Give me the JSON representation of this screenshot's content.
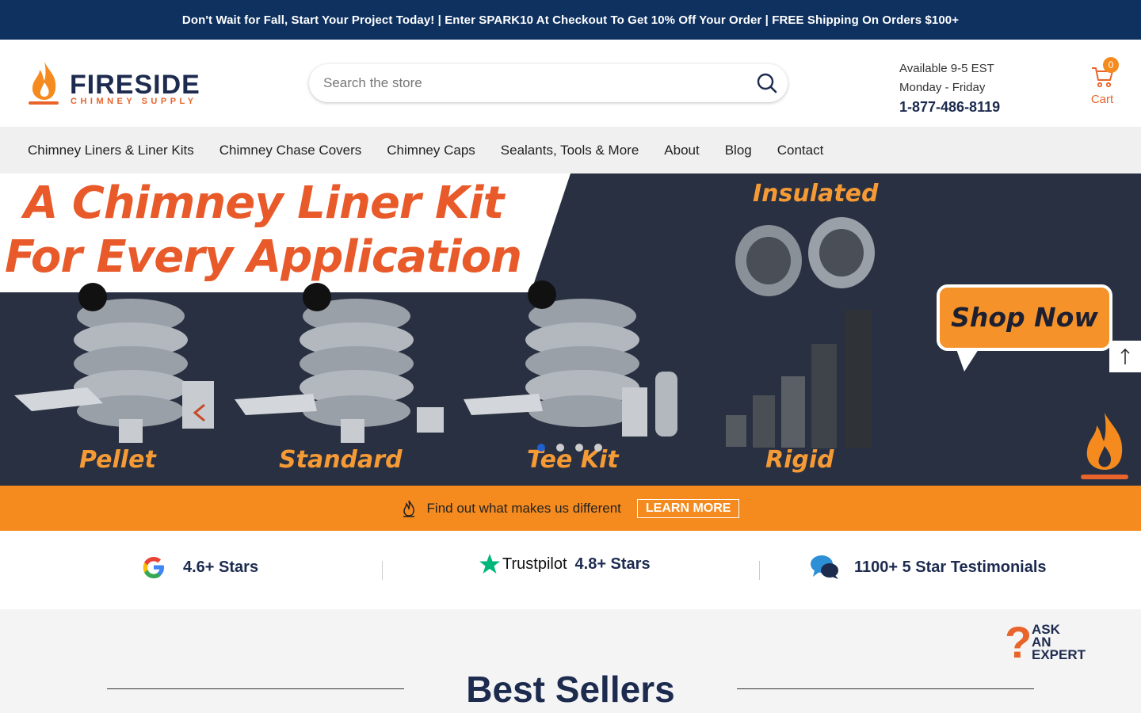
{
  "promo": {
    "text": "Don't Wait for Fall, Start Your Project Today! | Enter SPARK10 At Checkout To Get 10% Off Your Order | FREE Shipping On Orders $100+"
  },
  "header": {
    "logo_name": "FIRESIDE",
    "logo_sub": "CHIMNEY SUPPLY",
    "search_placeholder": "Search the store",
    "availability": "Available 9-5 EST",
    "days": "Monday - Friday",
    "phone": "1-877-486-8119",
    "cart_count": "0",
    "cart_label": "Cart"
  },
  "nav": {
    "items": [
      {
        "label": "Chimney Liners & Liner Kits"
      },
      {
        "label": "Chimney Chase Covers"
      },
      {
        "label": "Chimney Caps"
      },
      {
        "label": "Sealants, Tools & More"
      },
      {
        "label": "About"
      },
      {
        "label": "Blog"
      },
      {
        "label": "Contact"
      }
    ]
  },
  "hero": {
    "title_line1": "A Chimney Liner Kit",
    "title_line2": "For Every Application",
    "labels": [
      "Pellet",
      "Standard",
      "Tee Kit",
      "Rigid"
    ],
    "insulated": "Insulated",
    "cta": "Shop Now",
    "slide_count": 4,
    "active_slide": 0
  },
  "about_bar": {
    "text": "Find out what makes us different",
    "button": "LEARN MORE"
  },
  "ratings": [
    {
      "icon": "google-icon",
      "text": "4.6+ Stars"
    },
    {
      "icon": "trustpilot-icon",
      "brand": "Trustpilot",
      "text": "4.8+ Stars"
    },
    {
      "icon": "chat-bubbles-icon",
      "text": "1100+ 5 Star Testimonials"
    }
  ],
  "best_sellers": {
    "title": "Best Sellers"
  },
  "ask_expert": {
    "line1": "ASK",
    "line2": "AN",
    "line3": "EXPERT"
  },
  "colors": {
    "navy": "#0e3160",
    "orange": "#f58b1f",
    "flame": "#e8642a"
  }
}
